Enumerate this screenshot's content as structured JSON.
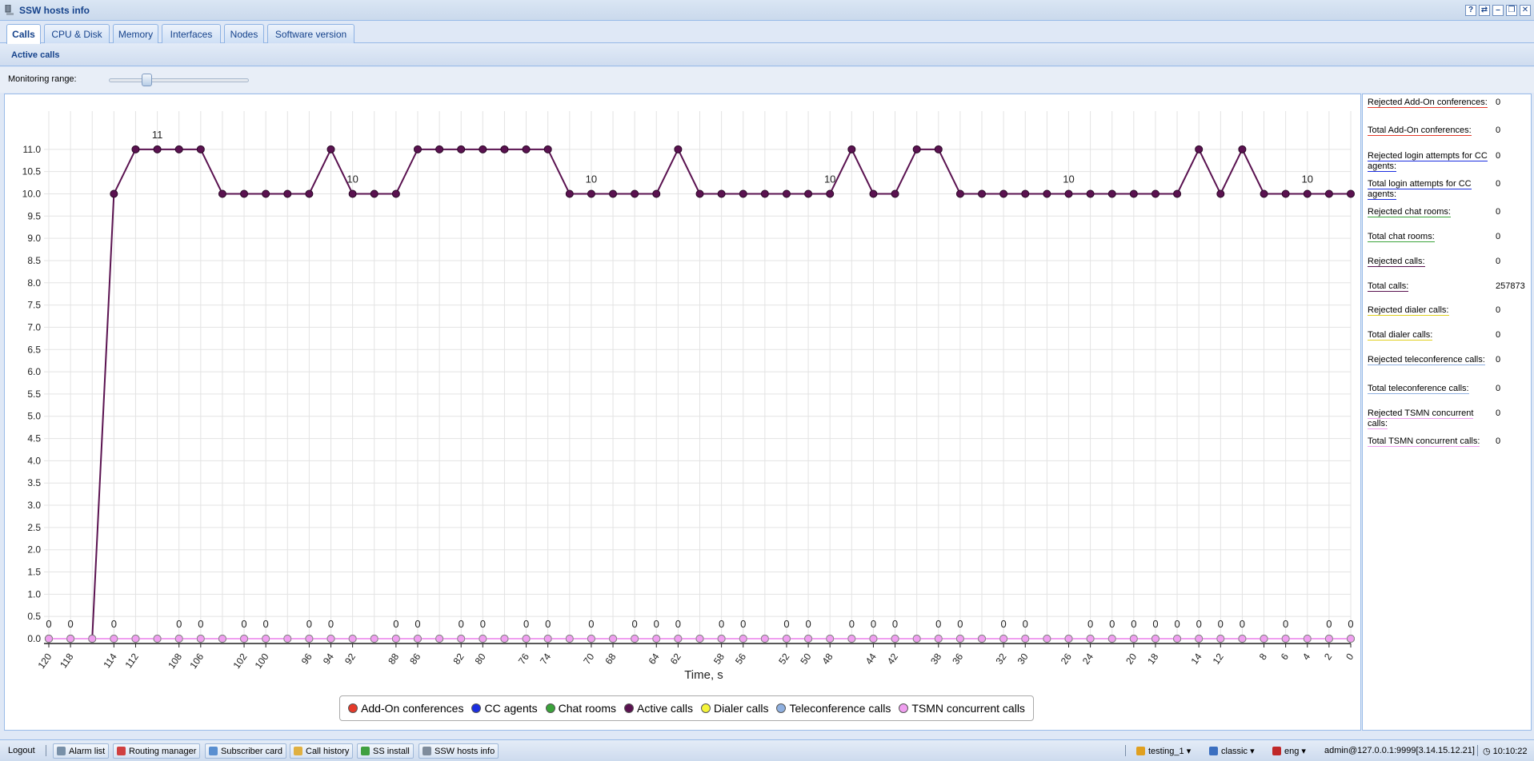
{
  "window": {
    "title": "SSW hosts info",
    "buttons": [
      "?",
      "⇄",
      "–",
      "❐",
      "✕"
    ]
  },
  "tabs": [
    {
      "label": "Calls",
      "active": true
    },
    {
      "label": "CPU & Disk",
      "active": false
    },
    {
      "label": "Memory",
      "active": false
    },
    {
      "label": "Interfaces",
      "active": false
    },
    {
      "label": "Nodes",
      "active": false
    },
    {
      "label": "Software version",
      "active": false
    }
  ],
  "panel": {
    "title": "Active calls",
    "range_label": "Monitoring range:",
    "range_position": 0.27
  },
  "chart_data": {
    "type": "line",
    "xlabel": "Time, s",
    "ylabel": "",
    "x": [
      120,
      118,
      116,
      114,
      112,
      110,
      108,
      106,
      104,
      102,
      100,
      98,
      96,
      94,
      92,
      90,
      88,
      86,
      84,
      82,
      80,
      78,
      76,
      74,
      72,
      70,
      68,
      66,
      64,
      62,
      60,
      58,
      56,
      54,
      52,
      50,
      48,
      46,
      44,
      42,
      40,
      38,
      36,
      34,
      32,
      30,
      28,
      26,
      24,
      22,
      20,
      18,
      16,
      14,
      12,
      10,
      8,
      6,
      4,
      2,
      0
    ],
    "x_tick_labels": [
      120,
      118,
      114,
      112,
      108,
      106,
      102,
      100,
      96,
      94,
      92,
      88,
      86,
      82,
      80,
      76,
      74,
      70,
      68,
      64,
      62,
      58,
      56,
      52,
      50,
      48,
      44,
      42,
      38,
      36,
      32,
      30,
      26,
      24,
      20,
      18,
      14,
      12,
      8,
      6,
      4,
      2,
      0
    ],
    "ylim": [
      0,
      11.5
    ],
    "y_ticks": [
      "0.0",
      "0.5",
      "1.0",
      "1.5",
      "2.0",
      "2.5",
      "3.0",
      "3.5",
      "4.0",
      "4.5",
      "5.0",
      "5.5",
      "6.0",
      "6.5",
      "7.0",
      "7.5",
      "8.0",
      "8.5",
      "9.0",
      "9.5",
      "10.0",
      "10.5",
      "11.0"
    ],
    "grid": true,
    "legend_position": "bottom",
    "series": [
      {
        "name": "Add-On conferences",
        "color": "#e53a2a",
        "values": [
          0,
          0,
          0,
          0,
          0,
          0,
          0,
          0,
          0,
          0,
          0,
          0,
          0,
          0,
          0,
          0,
          0,
          0,
          0,
          0,
          0,
          0,
          0,
          0,
          0,
          0,
          0,
          0,
          0,
          0,
          0,
          0,
          0,
          0,
          0,
          0,
          0,
          0,
          0,
          0,
          0,
          0,
          0,
          0,
          0,
          0,
          0,
          0,
          0,
          0,
          0,
          0,
          0,
          0,
          0,
          0,
          0,
          0,
          0,
          0,
          0
        ]
      },
      {
        "name": "CC agents",
        "color": "#1b2ee0",
        "values": [
          0,
          0,
          0,
          0,
          0,
          0,
          0,
          0,
          0,
          0,
          0,
          0,
          0,
          0,
          0,
          0,
          0,
          0,
          0,
          0,
          0,
          0,
          0,
          0,
          0,
          0,
          0,
          0,
          0,
          0,
          0,
          0,
          0,
          0,
          0,
          0,
          0,
          0,
          0,
          0,
          0,
          0,
          0,
          0,
          0,
          0,
          0,
          0,
          0,
          0,
          0,
          0,
          0,
          0,
          0,
          0,
          0,
          0,
          0,
          0,
          0
        ]
      },
      {
        "name": "Chat rooms",
        "color": "#3aa33a",
        "values": [
          0,
          0,
          0,
          0,
          0,
          0,
          0,
          0,
          0,
          0,
          0,
          0,
          0,
          0,
          0,
          0,
          0,
          0,
          0,
          0,
          0,
          0,
          0,
          0,
          0,
          0,
          0,
          0,
          0,
          0,
          0,
          0,
          0,
          0,
          0,
          0,
          0,
          0,
          0,
          0,
          0,
          0,
          0,
          0,
          0,
          0,
          0,
          0,
          0,
          0,
          0,
          0,
          0,
          0,
          0,
          0,
          0,
          0,
          0,
          0,
          0
        ]
      },
      {
        "name": "Active calls",
        "color": "#5a1250",
        "values": [
          0,
          0,
          0,
          10,
          11,
          11,
          11,
          11,
          10,
          10,
          10,
          10,
          10,
          11,
          10,
          10,
          10,
          11,
          11,
          11,
          11,
          11,
          11,
          11,
          10,
          10,
          10,
          10,
          10,
          11,
          10,
          10,
          10,
          10,
          10,
          10,
          10,
          11,
          10,
          10,
          11,
          11,
          10,
          10,
          10,
          10,
          10,
          10,
          10,
          10,
          10,
          10,
          10,
          11,
          10,
          11,
          10,
          10,
          10,
          10,
          10
        ]
      },
      {
        "name": "Dialer calls",
        "color": "#f5f53a",
        "values": [
          0,
          0,
          0,
          0,
          0,
          0,
          0,
          0,
          0,
          0,
          0,
          0,
          0,
          0,
          0,
          0,
          0,
          0,
          0,
          0,
          0,
          0,
          0,
          0,
          0,
          0,
          0,
          0,
          0,
          0,
          0,
          0,
          0,
          0,
          0,
          0,
          0,
          0,
          0,
          0,
          0,
          0,
          0,
          0,
          0,
          0,
          0,
          0,
          0,
          0,
          0,
          0,
          0,
          0,
          0,
          0,
          0,
          0,
          0,
          0,
          0
        ]
      },
      {
        "name": "Teleconference calls",
        "color": "#8fb0e0",
        "values": [
          0,
          0,
          0,
          0,
          0,
          0,
          0,
          0,
          0,
          0,
          0,
          0,
          0,
          0,
          0,
          0,
          0,
          0,
          0,
          0,
          0,
          0,
          0,
          0,
          0,
          0,
          0,
          0,
          0,
          0,
          0,
          0,
          0,
          0,
          0,
          0,
          0,
          0,
          0,
          0,
          0,
          0,
          0,
          0,
          0,
          0,
          0,
          0,
          0,
          0,
          0,
          0,
          0,
          0,
          0,
          0,
          0,
          0,
          0,
          0,
          0
        ]
      },
      {
        "name": "TSMN concurrent calls",
        "color": "#f09ff0",
        "values": [
          0,
          0,
          0,
          0,
          0,
          0,
          0,
          0,
          0,
          0,
          0,
          0,
          0,
          0,
          0,
          0,
          0,
          0,
          0,
          0,
          0,
          0,
          0,
          0,
          0,
          0,
          0,
          0,
          0,
          0,
          0,
          0,
          0,
          0,
          0,
          0,
          0,
          0,
          0,
          0,
          0,
          0,
          0,
          0,
          0,
          0,
          0,
          0,
          0,
          0,
          0,
          0,
          0,
          0,
          0,
          0,
          0,
          0,
          0,
          0,
          0
        ]
      }
    ],
    "annotations_top": [
      {
        "x": 110,
        "text": "11"
      },
      {
        "x": 92,
        "text": "10"
      },
      {
        "x": 70,
        "text": "10"
      },
      {
        "x": 48,
        "text": "10"
      },
      {
        "x": 26,
        "text": "10"
      },
      {
        "x": 4,
        "text": "10"
      }
    ],
    "zero_labels_x": [
      120,
      118,
      114,
      108,
      106,
      102,
      100,
      96,
      94,
      88,
      86,
      82,
      80,
      76,
      74,
      70,
      66,
      64,
      62,
      58,
      56,
      52,
      50,
      46,
      44,
      42,
      38,
      36,
      32,
      30,
      24,
      22,
      20,
      18,
      16,
      14,
      12,
      10,
      6,
      2,
      0
    ],
    "zero_label_text": "0"
  },
  "info": [
    {
      "label": "Rejected Add-On conferences:",
      "value": "0",
      "color": "#e53a2a"
    },
    {
      "label": "Total Add-On conferences:",
      "value": "0",
      "color": "#e53a2a"
    },
    {
      "label": "Rejected login attempts for CC agents:",
      "value": "0",
      "color": "#1b2ee0"
    },
    {
      "label": "Total login attempts for CC agents:",
      "value": "0",
      "color": "#1b2ee0"
    },
    {
      "label": "Rejected chat rooms:",
      "value": "0",
      "color": "#3aa33a"
    },
    {
      "label": "Total chat rooms:",
      "value": "0",
      "color": "#3aa33a"
    },
    {
      "label": "Rejected calls:",
      "value": "0",
      "color": "#5a1250"
    },
    {
      "label": "Total calls:",
      "value": "257873",
      "color": "#5a1250"
    },
    {
      "label": "Rejected dialer calls:",
      "value": "0",
      "color": "#e0d020"
    },
    {
      "label": "Total dialer calls:",
      "value": "0",
      "color": "#e0d020"
    },
    {
      "label": "Rejected teleconference calls:",
      "value": "0",
      "color": "#8fb0e0"
    },
    {
      "label": "Total teleconference calls:",
      "value": "0",
      "color": "#8fb0e0"
    },
    {
      "label": "Rejected TSMN concurrent calls:",
      "value": "0",
      "color": "#f09ff0"
    },
    {
      "label": "Total TSMN concurrent calls:",
      "value": "0",
      "color": "#f09ff0"
    }
  ],
  "taskbar": {
    "logout": "Logout",
    "items": [
      "Alarm list",
      "Routing manager",
      "Subscriber card",
      "Call history",
      "SS install",
      "SSW hosts info"
    ],
    "profile": "testing_1",
    "theme": "classic",
    "language": "eng",
    "user": "admin@127.0.0.1:9999[3.14.15.12.21]",
    "clock": "10:10:22"
  }
}
